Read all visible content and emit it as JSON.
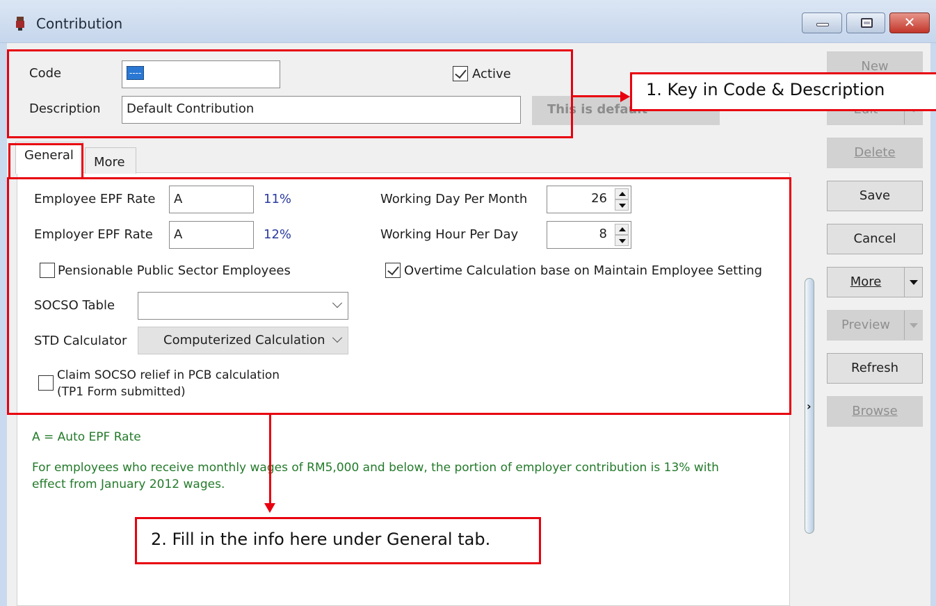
{
  "window": {
    "title": "Contribution",
    "icon": "app-icon",
    "controls": {
      "minimize": "minimize-icon",
      "maximize": "maximize-icon",
      "close": "✕"
    }
  },
  "header": {
    "code_label": "Code",
    "code_value": "----",
    "active_label": "Active",
    "active_checked": true,
    "description_label": "Description",
    "description_value": "Default Contribution",
    "default_button_label": "This is default"
  },
  "tabs": [
    {
      "label": "General",
      "selected": true
    },
    {
      "label": "More",
      "selected": false
    }
  ],
  "general": {
    "employee_epf_label": "Employee EPF Rate",
    "employee_epf_value": "A",
    "employee_epf_pct": "11%",
    "employer_epf_label": "Employer EPF Rate",
    "employer_epf_value": "A",
    "employer_epf_pct": "12%",
    "pensionable_label": "Pensionable Public Sector Employees",
    "pensionable_checked": false,
    "socso_table_label": "SOCSO Table",
    "socso_table_value": "",
    "std_calculator_label": "STD Calculator",
    "std_calculator_value": "Computerized Calculation",
    "claim_socso_label_line1": "Claim SOCSO relief in PCB calculation",
    "claim_socso_label_line2": "(TP1 Form submitted)",
    "claim_socso_checked": false,
    "working_day_label": "Working Day Per Month",
    "working_day_value": "26",
    "working_hour_label": "Working Hour Per Day",
    "working_hour_value": "8",
    "overtime_label": "Overtime Calculation base on Maintain Employee Setting",
    "overtime_checked": true
  },
  "notes": {
    "auto_epf": "A = Auto EPF Rate",
    "info_line1": "For employees who receive monthly wages of RM5,000 and below, the portion of employer contribution is 13% with",
    "info_line2": "effect from January 2012 wages."
  },
  "side_buttons": [
    {
      "label": "New",
      "enabled": false
    },
    {
      "label": "Edit",
      "enabled": false,
      "split": true
    },
    {
      "label": "Delete",
      "enabled": false
    },
    {
      "label": "Save",
      "enabled": true
    },
    {
      "label": "Cancel",
      "enabled": true
    },
    {
      "label": "More",
      "enabled": true,
      "split": true
    },
    {
      "label": "Preview",
      "enabled": false,
      "split": true
    },
    {
      "label": "Refresh",
      "enabled": true
    },
    {
      "label": "Browse",
      "enabled": false
    }
  ],
  "annotations": {
    "step1": "1. Key in Code & Description",
    "step2": "2. Fill in the info here under General tab.",
    "color": "#e8000f"
  },
  "colors": {
    "accent_blue": "#2a78d4",
    "percent_text": "#2a3aa0",
    "note_green": "#237a2a",
    "close_red": "#c2352a"
  }
}
